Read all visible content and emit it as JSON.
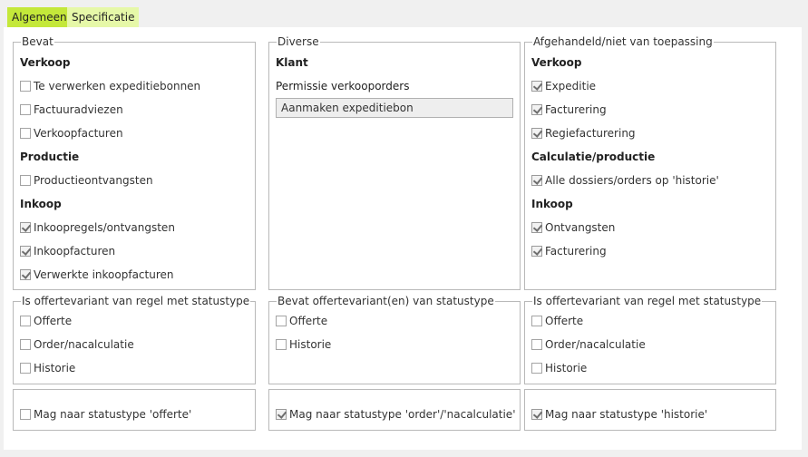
{
  "tabs": [
    {
      "label": "Algemeen",
      "active": true
    },
    {
      "label": "Specificatie",
      "active": false
    }
  ],
  "bevat": {
    "title": "Bevat",
    "verkoop_heading": "Verkoop",
    "verkoop_items": [
      {
        "label": "Te verwerken expeditiebonnen",
        "checked": false
      },
      {
        "label": "Factuuradviezen",
        "checked": false
      },
      {
        "label": "Verkoopfacturen",
        "checked": false
      }
    ],
    "productie_heading": "Productie",
    "productie_items": [
      {
        "label": "Productieontvangsten",
        "checked": false
      }
    ],
    "inkoop_heading": "Inkoop",
    "inkoop_items": [
      {
        "label": "Inkoopregels/ontvangsten",
        "checked": true
      },
      {
        "label": "Inkoopfacturen",
        "checked": true
      },
      {
        "label": "Verwerkte inkoopfacturen",
        "checked": true
      }
    ]
  },
  "diverse": {
    "title": "Diverse",
    "klant_heading": "Klant",
    "permissie_label": "Permissie verkooporders",
    "permissie_value": "Aanmaken expeditiebon"
  },
  "afgehandeld": {
    "title": "Afgehandeld/niet van toepassing",
    "verkoop_heading": "Verkoop",
    "verkoop_items": [
      {
        "label": "Expeditie",
        "checked": true
      },
      {
        "label": "Facturering",
        "checked": true
      },
      {
        "label": "Regiefacturering",
        "checked": true
      }
    ],
    "calc_heading": "Calculatie/productie",
    "calc_items": [
      {
        "label": "Alle dossiers/orders op 'historie'",
        "checked": true
      }
    ],
    "inkoop_heading": "Inkoop",
    "inkoop_items": [
      {
        "label": "Ontvangsten",
        "checked": true
      },
      {
        "label": "Facturering",
        "checked": true
      }
    ]
  },
  "status_groups": [
    {
      "title": "Is offertevariant van regel met statustype",
      "items": [
        {
          "label": "Offerte",
          "checked": false
        },
        {
          "label": "Order/nacalculatie",
          "checked": false
        },
        {
          "label": "Historie",
          "checked": false
        }
      ]
    },
    {
      "title": "Bevat offertevariant(en) van statustype",
      "items": [
        {
          "label": "Offerte",
          "checked": false
        },
        {
          "label": "Historie",
          "checked": false
        }
      ]
    },
    {
      "title": "Is offertevariant van regel met statustype",
      "items": [
        {
          "label": "Offerte",
          "checked": false
        },
        {
          "label": "Order/nacalculatie",
          "checked": false
        },
        {
          "label": "Historie",
          "checked": false
        }
      ]
    }
  ],
  "mag_naar": [
    {
      "label": "Mag naar statustype 'offerte'",
      "checked": false
    },
    {
      "label": "Mag naar statustype 'order'/'nacalculatie'",
      "checked": true
    },
    {
      "label": "Mag naar statustype 'historie'",
      "checked": true
    }
  ]
}
